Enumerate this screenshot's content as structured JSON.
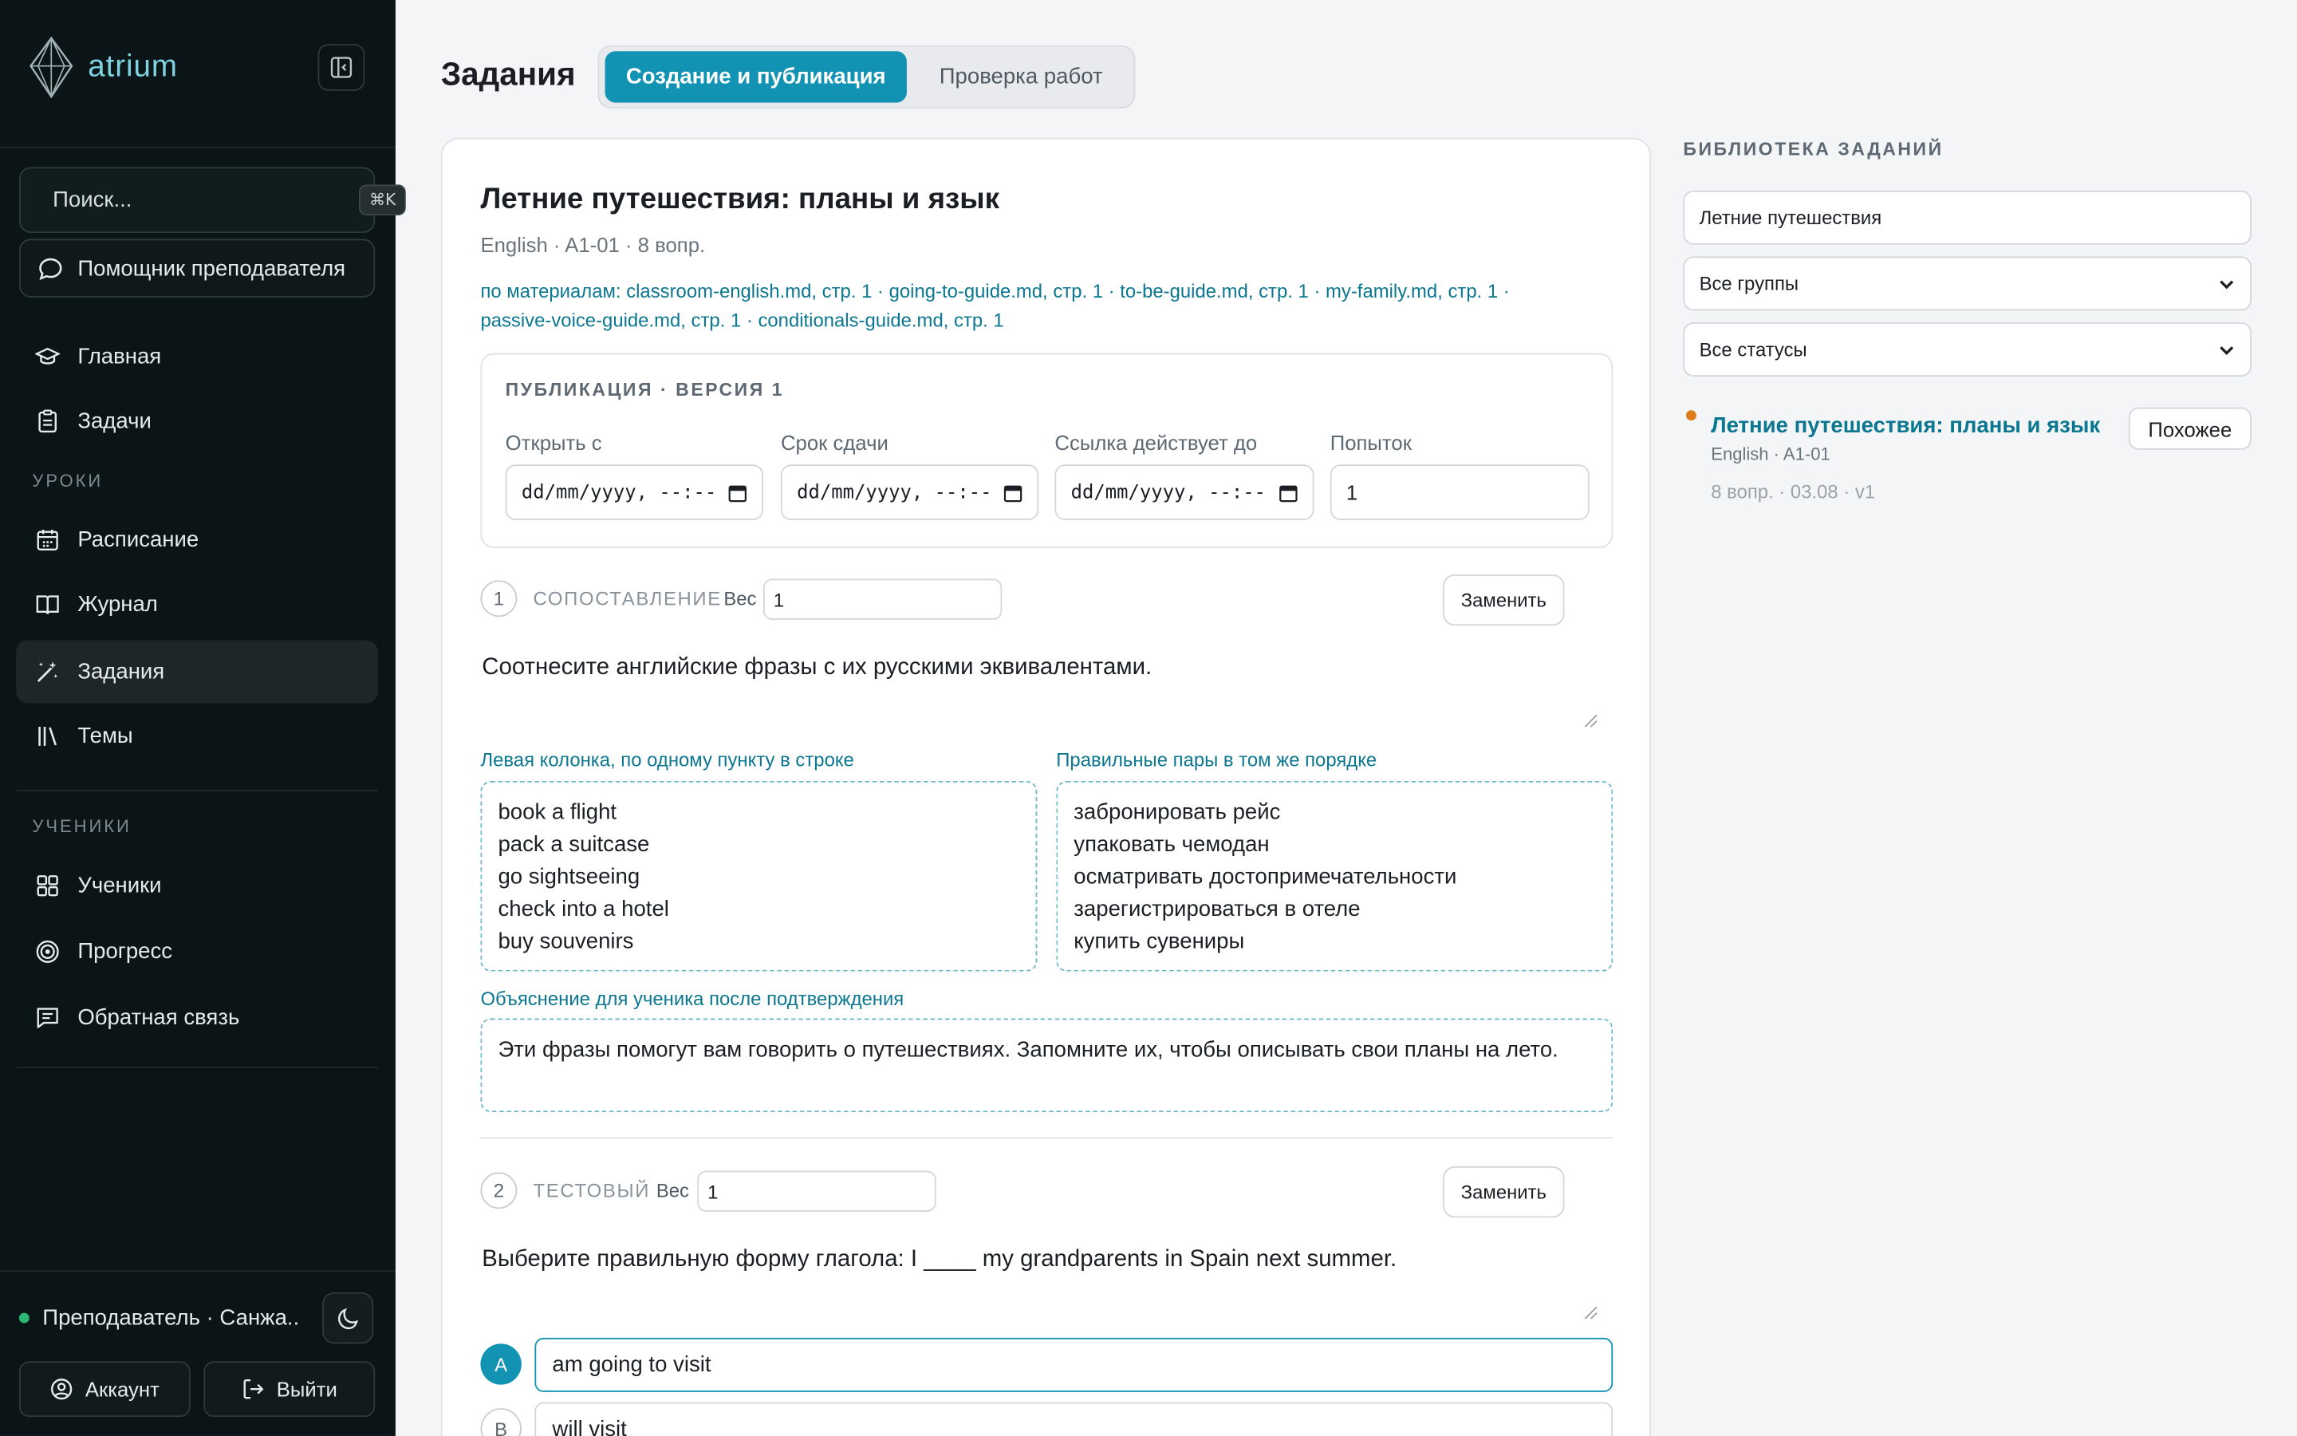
{
  "app": {
    "name": "atrium"
  },
  "sidebar": {
    "search_placeholder": "Поиск...",
    "search_shortcut": "⌘K",
    "assistant_label": "Помощник преподавателя",
    "items_top": [
      {
        "label": "Главная",
        "icon": "graduation-cap-icon"
      },
      {
        "label": "Задачи",
        "icon": "clipboard-icon"
      }
    ],
    "section_lessons": "УРОКИ",
    "items_lessons": [
      {
        "label": "Расписание",
        "icon": "calendar-icon"
      },
      {
        "label": "Журнал",
        "icon": "book-open-icon"
      },
      {
        "label": "Задания",
        "icon": "magic-wand-icon",
        "active": true
      },
      {
        "label": "Темы",
        "icon": "library-icon"
      }
    ],
    "section_students": "УЧЕНИКИ",
    "items_students": [
      {
        "label": "Ученики",
        "icon": "grid-icon"
      },
      {
        "label": "Прогресс",
        "icon": "target-icon"
      },
      {
        "label": "Обратная связь",
        "icon": "message-icon"
      }
    ],
    "user": "Преподаватель · Санжа...",
    "account_label": "Аккаунт",
    "logout_label": "Выйти"
  },
  "header": {
    "title": "Задания",
    "tabs": [
      {
        "label": "Создание и публикация",
        "active": true
      },
      {
        "label": "Проверка работ",
        "active": false
      }
    ]
  },
  "assignment": {
    "title": "Летние путешествия: планы и язык",
    "meta": "English · A1-01 · 8 вопр.",
    "materials_line1": "по материалам: classroom-english.md, стр. 1 · going-to-guide.md, стр. 1 · to-be-guide.md, стр. 1 · my-family.md, стр. 1 ·",
    "materials_line2": "passive-voice-guide.md, стр. 1 · conditionals-guide.md, стр. 1",
    "publication": {
      "label": "ПУБЛИКАЦИЯ · ВЕРСИЯ 1",
      "open_label": "Открыть с",
      "open_value": "dd/mm/yyyy, --:--",
      "due_label": "Срок сдачи",
      "due_value": "dd/mm/yyyy, --:--",
      "link_label": "Ссылка действует до",
      "link_value": "dd/mm/yyyy, --:--",
      "attempts_label": "Попыток",
      "attempts_value": "1"
    },
    "questions": [
      {
        "number": "1",
        "type": "СОПОСТАВЛЕНИЕ",
        "weight_label": "Вес",
        "weight": "1",
        "replace_label": "Заменить",
        "prompt": "Соотнесите английские фразы с их русскими эквивалентами.",
        "left_label": "Левая колонка, по одному пункту в строке",
        "left_items": [
          "book a flight",
          "pack a suitcase",
          "go sightseeing",
          "check into a hotel",
          "buy souvenirs"
        ],
        "right_label": "Правильные пары в том же порядке",
        "right_items": [
          "забронировать рейс",
          "упаковать чемодан",
          "осматривать достопримечательности",
          "зарегистрироваться в отеле",
          "купить сувениры"
        ],
        "explanation_label": "Объяснение для ученика после подтверждения",
        "explanation": "Эти фразы помогут вам говорить о путешествиях. Запомните их, чтобы описывать свои планы на лето."
      },
      {
        "number": "2",
        "type": "ТЕСТОВЫЙ",
        "weight_label": "Вес",
        "weight": "1",
        "replace_label": "Заменить",
        "prompt": "Выберите правильную форму глагола: I ____ my grandparents in Spain next summer.",
        "options": [
          {
            "letter": "A",
            "text": "am going to visit",
            "correct": true
          },
          {
            "letter": "B",
            "text": "will visit",
            "correct": false
          }
        ]
      }
    ]
  },
  "library": {
    "title": "БИБЛИОТЕКА ЗАДАНИЙ",
    "search_value": "Летние путешествия",
    "group_filter": "Все группы",
    "status_filter": "Все статусы",
    "items": [
      {
        "title": "Летние путешествия: планы и язык",
        "subtitle": "English · A1-01",
        "details": "8 вопр. · 03.08 · v1",
        "similar_label": "Похожее"
      }
    ]
  },
  "colors": {
    "accent": "#1293b4",
    "link": "#0b7790",
    "sidebar_bg": "#0b1416",
    "status_dot": "#e07b1a",
    "online": "#2bb673"
  }
}
